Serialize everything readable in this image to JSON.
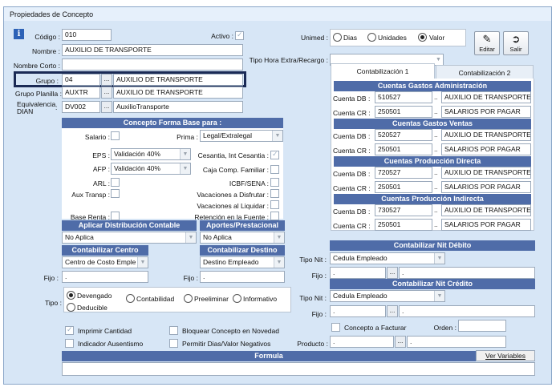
{
  "window": {
    "title": "Propiedades de Concepto"
  },
  "fields": {
    "codigo": {
      "label": "Código :",
      "value": "010"
    },
    "activo": {
      "label": "Activo :"
    },
    "nombre": {
      "label": "Nombre :",
      "value": "AUXILIO DE TRANSPORTE"
    },
    "nombre_corto": {
      "label": "Nombre Corto :",
      "value": ""
    },
    "grupo": {
      "label": "Grupo :",
      "code": "04",
      "desc": "AUXILIO DE TRANSPORTE"
    },
    "grupo_planilla": {
      "label": "Grupo Planilla :",
      "code": "AUXTR",
      "desc": "AUXILIO DE TRANSPORTE"
    },
    "equivalencia": {
      "label1": "Equivalencia",
      "label2": "DIAN",
      "code": "DV002",
      "desc": "AuxilioTransporte"
    },
    "unimed": {
      "label": "Unimed :",
      "options": [
        "Dias",
        "Unidades",
        "Valor"
      ],
      "selected": "Valor"
    },
    "tipo_hora": {
      "label": "Tipo Hora Extra/Recargo :",
      "value": ""
    }
  },
  "toolbar": {
    "editar": "Editar",
    "salir": "Salir"
  },
  "tabs": [
    "Contabilización 1",
    "Contabilización 2"
  ],
  "contab": {
    "sections": [
      {
        "title": "Cuentas Gastos Administración",
        "db_code": "510527",
        "db_desc": "AUXILIO DE TRANSPORTE",
        "cr_code": "250501",
        "cr_desc": "SALARIOS POR PAGAR"
      },
      {
        "title": "Cuentas Gastos Ventas",
        "db_code": "520527",
        "db_desc": "AUXILIO DE TRANSPORTE",
        "cr_code": "250501",
        "cr_desc": "SALARIOS POR PAGAR"
      },
      {
        "title": "Cuentas Producción Directa",
        "db_code": "720527",
        "db_desc": "AUXILIO DE TRANSPORTE",
        "cr_code": "250501",
        "cr_desc": "SALARIOS POR PAGAR"
      },
      {
        "title": "Cuentas Producción Indirecta",
        "db_code": "730527",
        "db_desc": "AUXILIO DE TRANSPORTE",
        "cr_code": "250501",
        "cr_desc": "SALARIOS POR PAGAR"
      }
    ],
    "db_label": "Cuenta DB :",
    "cr_label": "Cuenta CR :"
  },
  "forma_base": {
    "title": "Concepto Forma Base para :",
    "salario": "Salario :",
    "prima": {
      "label": "Prima :",
      "value": "Legal/Extralegal"
    },
    "eps": {
      "label": "EPS :",
      "value": "Validación 40%"
    },
    "cesantia": "Cesantia, Int Cesantia :",
    "afp": {
      "label": "AFP :",
      "value": "Validación 40%"
    },
    "caja": "Caja Comp. Familiar :",
    "arl": "ARL :",
    "icbf": "ICBF/SENA :",
    "aux_transp": "Aux Transp :",
    "vac_disfrutar": "Vacaciones a Disfrutar :",
    "vac_liquidar": "Vacaciones al Liquidar :",
    "base_renta": "Base Renta :",
    "retencion": "Retención en la Fuente :"
  },
  "aplicar": {
    "title": "Aplicar Distribución Contable",
    "value": "No Aplica"
  },
  "aportes": {
    "title": "Aportes/Prestacional",
    "value": "No Aplica"
  },
  "centro": {
    "title": "Contabilizar Centro",
    "value": "Centro de Costo Emple",
    "fijo_label": "Fijo :",
    "fijo_value": "."
  },
  "destino": {
    "title": "Contabilizar Destino",
    "value": "Destino Empleado",
    "fijo_label": "Fijo :",
    "fijo_value": "."
  },
  "tipo": {
    "label": "Tipo :",
    "options": [
      "Devengado",
      "Contabilidad",
      "Preeliminar",
      "Informativo",
      "Deducible"
    ],
    "selected": "Devengado"
  },
  "nit_debito": {
    "title": "Contabilizar Nit Débito",
    "tipo_label": "Tipo Nit :",
    "tipo_value": "Cedula Empleado",
    "fijo_label": "Fijo :",
    "fijo_value": ".",
    "fijo_value2": "."
  },
  "nit_credito": {
    "title": "Contabilizar Nit Crédito",
    "tipo_label": "Tipo Nit :",
    "tipo_value": "Cedula Empleado",
    "fijo_label": "Fijo :",
    "fijo_value": ".",
    "fijo_value2": "."
  },
  "options": {
    "imprimir": "Imprimir Cantidad",
    "bloquear": "Bloquear Concepto en Novedad",
    "indicador": "Indicador Ausentismo",
    "permitir": "Permitir Dias/Valor Negativos",
    "concepto_facturar": "Concepto a Facturar",
    "orden": "Orden :"
  },
  "producto": {
    "label": "Producto :",
    "value": ".",
    "value2": "."
  },
  "formula": {
    "title": "Formula",
    "ver": "Ver Variables"
  },
  "colors": {
    "header": "#4f6ca8",
    "window_bg": "#d7e6f6",
    "highlight": "#1a2a55"
  }
}
